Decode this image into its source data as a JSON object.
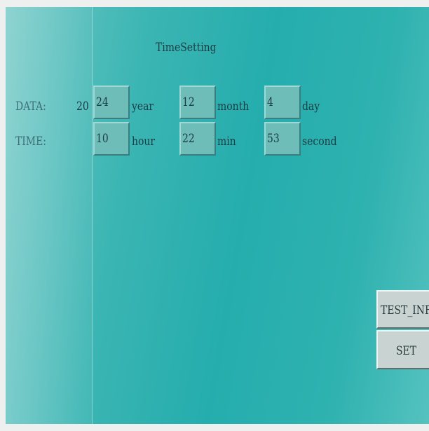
{
  "screen": {
    "title": "TimeSetting"
  },
  "date_row": {
    "label": "DATA:",
    "year_prefix": "20",
    "year": "24",
    "year_unit": "year",
    "month": "12",
    "month_unit": "month",
    "day": "4",
    "day_unit": "day"
  },
  "time_row": {
    "label": "TIME:",
    "hour": "10",
    "hour_unit": "hour",
    "minute": "22",
    "minute_unit": "min",
    "second": "53",
    "second_unit": "second"
  },
  "buttons": {
    "test_info_label": "TEST_INF",
    "set_label": "SET"
  },
  "colors": {
    "screen_bg": "#25adad",
    "field_bg": "#6fbdb9",
    "button_bg": "#c9d4d2",
    "text": "#1c3c44"
  }
}
